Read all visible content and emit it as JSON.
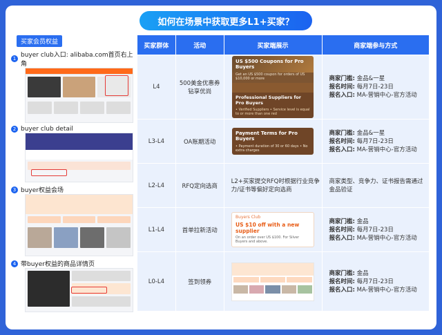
{
  "title": "如何在场景中获取更多L1+买家？",
  "left_panel": {
    "header": "买家会员权益",
    "steps": [
      {
        "num": "1",
        "label": "buyer club入口: alibaba.com首页右上角"
      },
      {
        "num": "2",
        "label": "buyer club detail"
      },
      {
        "num": "3",
        "label": "buyer权益会场"
      },
      {
        "num": "4",
        "label": "带buyer权益的商品详情页"
      }
    ]
  },
  "table": {
    "headers": [
      "买家群体",
      "活动",
      "买家端展示",
      "商家端参与方式"
    ],
    "rows": [
      {
        "group": "L4",
        "activity": "500美金优惠券\n钻享优尚",
        "card": {
          "kind": "dark",
          "top": "US $500 Coupons for Pro Buyers",
          "sub": "Get an US $500 coupon for orders of US $10,000 or more",
          "foot": "Professional Suppliers for Pro Buyers",
          "foot_sub": "• Verified Suppliers  • Service level is equal to or more than one red"
        },
        "merchant": [
          {
            "k": "商家门槛:",
            "v": "金品&一星"
          },
          {
            "k": "报名时间:",
            "v": "每月7日-23日"
          },
          {
            "k": "报名入口:",
            "v": "MA-营销中心-官方活动"
          }
        ]
      },
      {
        "group": "L3-L4",
        "activity": "OA账期活动",
        "card": {
          "kind": "payment",
          "top": "Payment Terms for Pro Buyers",
          "sub": "• Payment duration of 30 or 60 days  • No extra charges"
        },
        "merchant": [
          {
            "k": "商家门槛:",
            "v": "金品&一星"
          },
          {
            "k": "报名时间:",
            "v": "每月7日-23日"
          },
          {
            "k": "报名入口:",
            "v": "MA-营销中心-官方活动"
          }
        ]
      },
      {
        "group": "L2-L4",
        "activity": "RFQ定向选商",
        "display_text": "L2+买家提交RFQ时根据行业竞争力/证书等偏好定向选商",
        "merchant_text": "商家类型、竞争力、证书报告需通过金品验证"
      },
      {
        "group": "L1-L4",
        "activity": "首单拉新活动",
        "card": {
          "kind": "white",
          "logo": "Buyers Club",
          "top": "US $10 off with a new supplier",
          "sub": "On an order over US $100. For Silver Buyers and above."
        },
        "merchant": [
          {
            "k": "商家门槛:",
            "v": "金品"
          },
          {
            "k": "报名时间:",
            "v": "每月7日-23日"
          },
          {
            "k": "报名入口:",
            "v": "MA-营销中心-官方活动"
          }
        ]
      },
      {
        "group": "L0-L4",
        "activity": "签到领券",
        "merchant": [
          {
            "k": "商家门槛:",
            "v": "金品"
          },
          {
            "k": "报名时间:",
            "v": "每月7日-23日"
          },
          {
            "k": "报名入口:",
            "v": "MA-营销中心-官方活动"
          }
        ]
      }
    ]
  },
  "colors": {
    "brand_blue": "#2a6ef0",
    "row_bg": "#eaf1fd",
    "frame_bg": "#2f63d8"
  }
}
